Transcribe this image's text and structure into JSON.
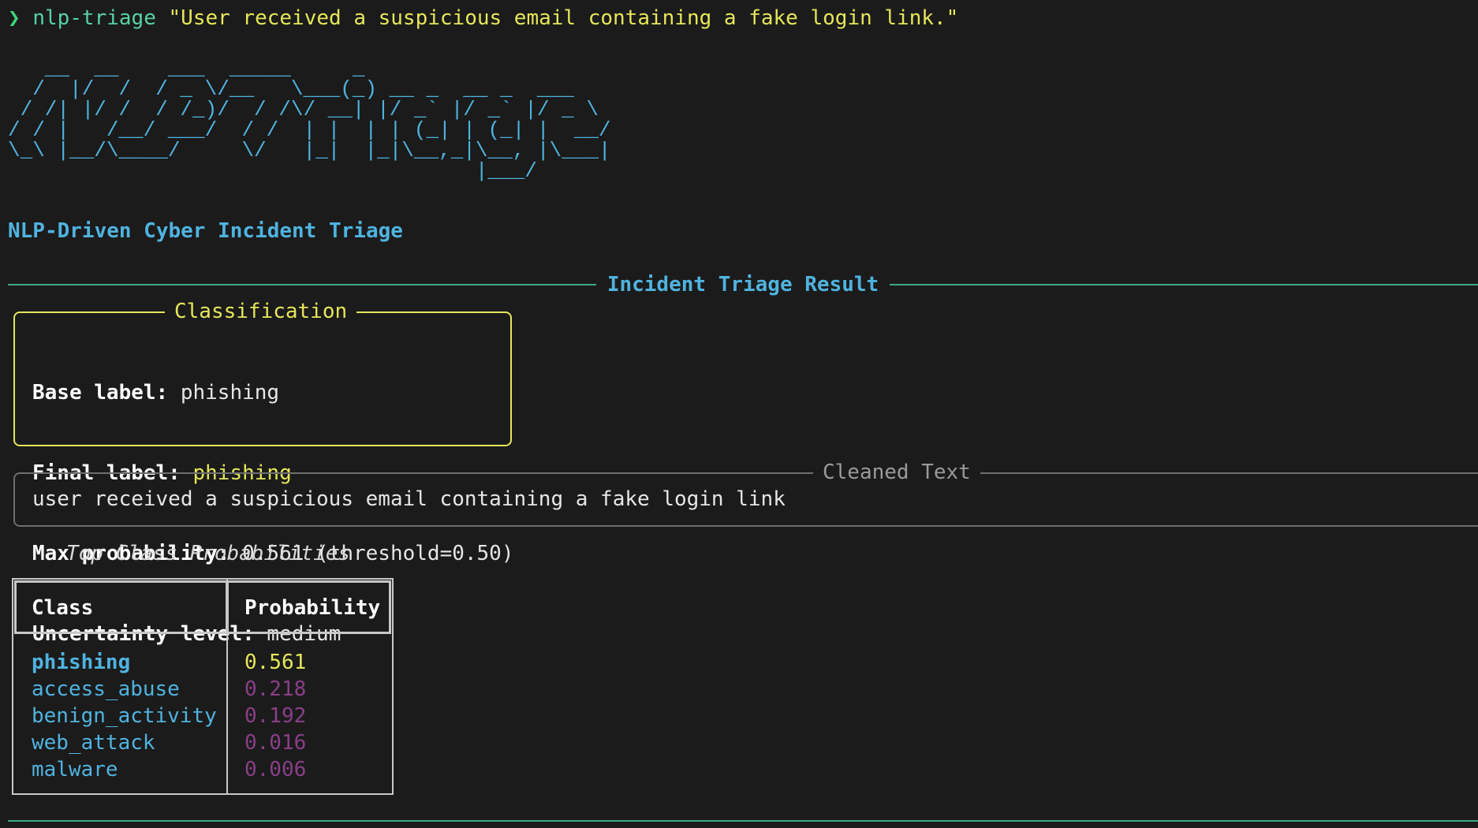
{
  "prompt": {
    "symbol": "❯",
    "command": "nlp-triage",
    "argument": "\"User received a suspicious email containing a fake login link.\""
  },
  "logo": {
    "ascii": "   __  __    ___  _____     _\n  /  |/  /  / _ \\/__   \\___(_) __ _  __ _  ___\n / /| |/ /  / /_)/  / /\\/ __| |/ _` |/ _` |/ _ \\\n/ / |   /__/ ___/  / /  | |  | | (_| | (_| |  __/\n\\_\\ |__/\\____/     \\/   |_|  |_|\\__,_|\\__, |\\___|\n                                      |___/",
    "tagline": "NLP-Driven Cyber Incident Triage"
  },
  "result": {
    "rule_title": "Incident Triage Result",
    "classification": {
      "title": "Classification",
      "base_label_key": "Base label:",
      "base_label_value": "phishing",
      "final_label_key": "Final label:",
      "final_label_value": "phishing",
      "max_prob_key": "Max probability:",
      "max_prob_value": "0.561 (threshold=0.50)",
      "uncertainty_key": "Uncertainty level:",
      "uncertainty_value": "medium"
    },
    "cleaned": {
      "title": "Cleaned Text",
      "text": "user received a suspicious email containing a fake login link"
    },
    "table": {
      "caption": "Top Class Probabilities",
      "headers": {
        "class": "Class",
        "probability": "Probability"
      },
      "rows": [
        {
          "class": "phishing",
          "probability": "0.561"
        },
        {
          "class": "access_abuse",
          "probability": "0.218"
        },
        {
          "class": "benign_activity",
          "probability": "0.192"
        },
        {
          "class": "web_attack",
          "probability": "0.016"
        },
        {
          "class": "malware",
          "probability": "0.006"
        }
      ]
    }
  },
  "colors": {
    "background": "#1b1b1b",
    "accent_cyan": "#4fb3df",
    "accent_yellow": "#e6e65a",
    "rule_green": "#3ba981",
    "low_prob_purple": "#8a3f88"
  }
}
